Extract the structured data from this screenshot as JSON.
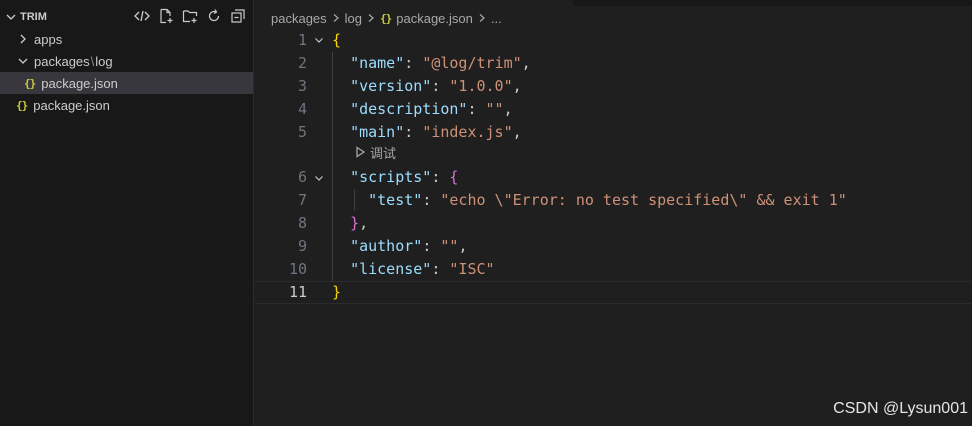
{
  "explorer": {
    "title": "TRIM",
    "actions": [
      {
        "name": "collapse-code-icon"
      },
      {
        "name": "new-file-icon"
      },
      {
        "name": "new-folder-icon"
      },
      {
        "name": "refresh-icon"
      },
      {
        "name": "collapse-all-icon"
      }
    ],
    "items": [
      {
        "label": "apps",
        "type": "folder",
        "expanded": false
      },
      {
        "label_a": "packages",
        "sep": "\\",
        "label_b": "log",
        "type": "folder",
        "expanded": true
      },
      {
        "label": "package.json",
        "type": "json",
        "selected": true,
        "icon": "{}"
      },
      {
        "label": "package.json",
        "type": "json",
        "icon": "{}"
      }
    ]
  },
  "breadcrumb": {
    "parts": [
      "packages",
      "log"
    ],
    "file": "package.json",
    "file_icon": "{}",
    "tail": "..."
  },
  "editor": {
    "codelens": "调试",
    "lines": [
      {
        "n": "1",
        "tokens": [
          {
            "t": "{",
            "c": "b"
          }
        ]
      },
      {
        "n": "2",
        "tokens": [
          {
            "t": "  "
          },
          {
            "t": "\"name\"",
            "c": "k"
          },
          {
            "t": ": ",
            "c": "p"
          },
          {
            "t": "\"@log/trim\"",
            "c": "s"
          },
          {
            "t": ",",
            "c": "p"
          }
        ]
      },
      {
        "n": "3",
        "tokens": [
          {
            "t": "  "
          },
          {
            "t": "\"version\"",
            "c": "k"
          },
          {
            "t": ": ",
            "c": "p"
          },
          {
            "t": "\"1.0.0\"",
            "c": "s"
          },
          {
            "t": ",",
            "c": "p"
          }
        ]
      },
      {
        "n": "4",
        "tokens": [
          {
            "t": "  "
          },
          {
            "t": "\"description\"",
            "c": "k"
          },
          {
            "t": ": ",
            "c": "p"
          },
          {
            "t": "\"\"",
            "c": "s"
          },
          {
            "t": ",",
            "c": "p"
          }
        ]
      },
      {
        "n": "5",
        "tokens": [
          {
            "t": "  "
          },
          {
            "t": "\"main\"",
            "c": "k"
          },
          {
            "t": ": ",
            "c": "p"
          },
          {
            "t": "\"index.js\"",
            "c": "s"
          },
          {
            "t": ",",
            "c": "p"
          }
        ]
      },
      {
        "n": "6",
        "tokens": [
          {
            "t": "  "
          },
          {
            "t": "\"scripts\"",
            "c": "k"
          },
          {
            "t": ": ",
            "c": "p"
          },
          {
            "t": "{",
            "c": "b2"
          }
        ]
      },
      {
        "n": "7",
        "tokens": [
          {
            "t": "    "
          },
          {
            "t": "\"test\"",
            "c": "k"
          },
          {
            "t": ": ",
            "c": "p"
          },
          {
            "t": "\"echo \\\"Error: no test specified\\\" && exit 1\"",
            "c": "s"
          }
        ]
      },
      {
        "n": "8",
        "tokens": [
          {
            "t": "  "
          },
          {
            "t": "}",
            "c": "b2"
          },
          {
            "t": ",",
            "c": "p"
          }
        ]
      },
      {
        "n": "9",
        "tokens": [
          {
            "t": "  "
          },
          {
            "t": "\"author\"",
            "c": "k"
          },
          {
            "t": ": ",
            "c": "p"
          },
          {
            "t": "\"\"",
            "c": "s"
          },
          {
            "t": ",",
            "c": "p"
          }
        ]
      },
      {
        "n": "10",
        "tokens": [
          {
            "t": "  "
          },
          {
            "t": "\"license\"",
            "c": "k"
          },
          {
            "t": ": ",
            "c": "p"
          },
          {
            "t": "\"ISC\"",
            "c": "s"
          }
        ]
      },
      {
        "n": "11",
        "tokens": [
          {
            "t": "}",
            "c": "b"
          }
        ],
        "current": true
      }
    ]
  },
  "watermark": "CSDN @Lysun001",
  "colors": {
    "key": "#9cdcfe",
    "string": "#ce9178",
    "bracket1": "#ffd700",
    "bracket2": "#da70d6",
    "json_icon": "#cbcb41"
  }
}
